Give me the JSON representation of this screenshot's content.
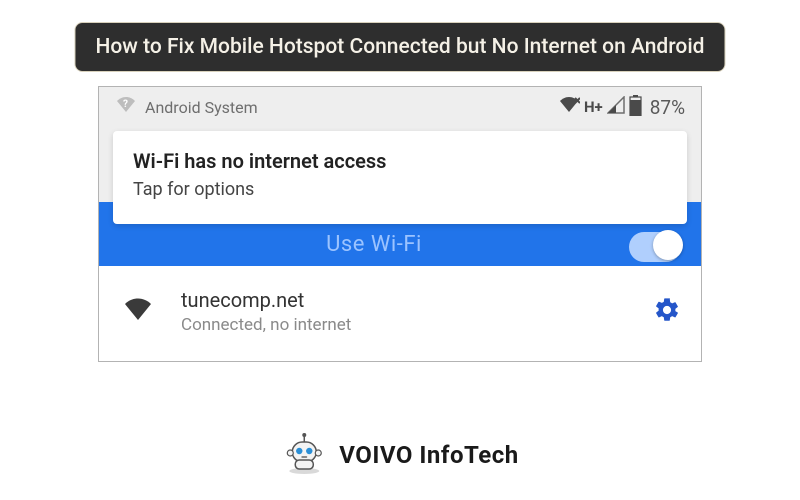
{
  "title": "How to Fix Mobile Hotspot Connected but No Internet on Android",
  "statusbar": {
    "system_label": "Android System",
    "network_indicator": "H+",
    "battery_pct": "87%"
  },
  "notification": {
    "title": "Wi-Fi has no internet access",
    "subtitle": "Tap for options"
  },
  "wifi_panel": {
    "header_partial": "Use Wi-Fi",
    "toggle_on": true
  },
  "network": {
    "ssid": "tunecomp.net",
    "status": "Connected, no internet"
  },
  "brand": {
    "name": "VOIVO InfoTech"
  }
}
